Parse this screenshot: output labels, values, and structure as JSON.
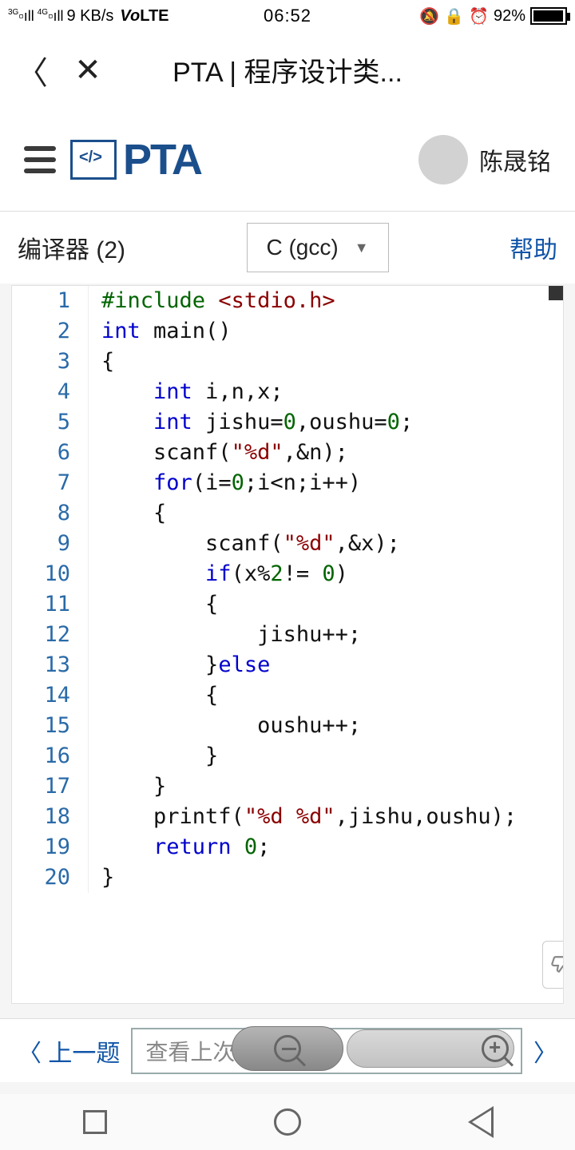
{
  "status": {
    "net_speed": "9 KB/s",
    "volte": "VoLTE",
    "time": "06:52",
    "battery_pct": "92%",
    "sig1_label": "3G",
    "sig2_label": "4G"
  },
  "browser": {
    "title": "PTA | 程序设计类..."
  },
  "header": {
    "brand": "PTA",
    "username": "陈晟铭"
  },
  "compiler": {
    "label": "编译器 (2)",
    "selected": "C (gcc)",
    "help": "帮助"
  },
  "code": {
    "lines": [
      {
        "n": 1,
        "tokens": [
          {
            "c": "c-pp",
            "t": "#include"
          },
          {
            "t": " "
          },
          {
            "c": "c-inc",
            "t": "<stdio.h>"
          }
        ]
      },
      {
        "n": 2,
        "tokens": [
          {
            "c": "c-kw",
            "t": "int"
          },
          {
            "t": " main()"
          }
        ]
      },
      {
        "n": 3,
        "tokens": [
          {
            "t": "{"
          }
        ]
      },
      {
        "n": 4,
        "tokens": [
          {
            "t": "    "
          },
          {
            "c": "c-kw",
            "t": "int"
          },
          {
            "t": " i,n,x;"
          }
        ]
      },
      {
        "n": 5,
        "tokens": [
          {
            "t": "    "
          },
          {
            "c": "c-kw",
            "t": "int"
          },
          {
            "t": " jishu="
          },
          {
            "c": "c-num",
            "t": "0"
          },
          {
            "t": ",oushu="
          },
          {
            "c": "c-num",
            "t": "0"
          },
          {
            "t": ";"
          }
        ]
      },
      {
        "n": 6,
        "tokens": [
          {
            "t": "    scanf("
          },
          {
            "c": "c-str",
            "t": "\"%d\""
          },
          {
            "t": ",&n);"
          }
        ]
      },
      {
        "n": 7,
        "tokens": [
          {
            "t": "    "
          },
          {
            "c": "c-kw",
            "t": "for"
          },
          {
            "t": "(i="
          },
          {
            "c": "c-num",
            "t": "0"
          },
          {
            "t": ";i<n;i++)"
          }
        ]
      },
      {
        "n": 8,
        "tokens": [
          {
            "t": "    {"
          }
        ]
      },
      {
        "n": 9,
        "tokens": [
          {
            "t": "        scanf("
          },
          {
            "c": "c-str",
            "t": "\"%d\""
          },
          {
            "t": ",&x);"
          }
        ]
      },
      {
        "n": 10,
        "tokens": [
          {
            "t": "        "
          },
          {
            "c": "c-kw",
            "t": "if"
          },
          {
            "t": "(x%"
          },
          {
            "c": "c-num",
            "t": "2"
          },
          {
            "t": "!= "
          },
          {
            "c": "c-num",
            "t": "0"
          },
          {
            "t": ")"
          }
        ]
      },
      {
        "n": 11,
        "tokens": [
          {
            "t": "        {"
          }
        ]
      },
      {
        "n": 12,
        "tokens": [
          {
            "t": "            jishu++;"
          }
        ]
      },
      {
        "n": 13,
        "tokens": [
          {
            "t": "        }"
          },
          {
            "c": "c-kw",
            "t": "else"
          }
        ]
      },
      {
        "n": 14,
        "tokens": [
          {
            "t": "        {"
          }
        ]
      },
      {
        "n": 15,
        "tokens": [
          {
            "t": "            oushu++;"
          }
        ]
      },
      {
        "n": 16,
        "tokens": [
          {
            "t": "        }"
          }
        ]
      },
      {
        "n": 17,
        "tokens": [
          {
            "t": "    }"
          }
        ]
      },
      {
        "n": 18,
        "tokens": [
          {
            "t": "    printf("
          },
          {
            "c": "c-str",
            "t": "\"%d %d\""
          },
          {
            "t": ",jishu,oushu);"
          }
        ]
      },
      {
        "n": 19,
        "tokens": [
          {
            "t": "    "
          },
          {
            "c": "c-kw",
            "t": "return"
          },
          {
            "t": " "
          },
          {
            "c": "c-num",
            "t": "0"
          },
          {
            "t": ";"
          }
        ]
      },
      {
        "n": 20,
        "tokens": [
          {
            "t": "}"
          }
        ]
      }
    ]
  },
  "footer": {
    "prev": "上一题",
    "search_placeholder": "查看上次提交"
  }
}
